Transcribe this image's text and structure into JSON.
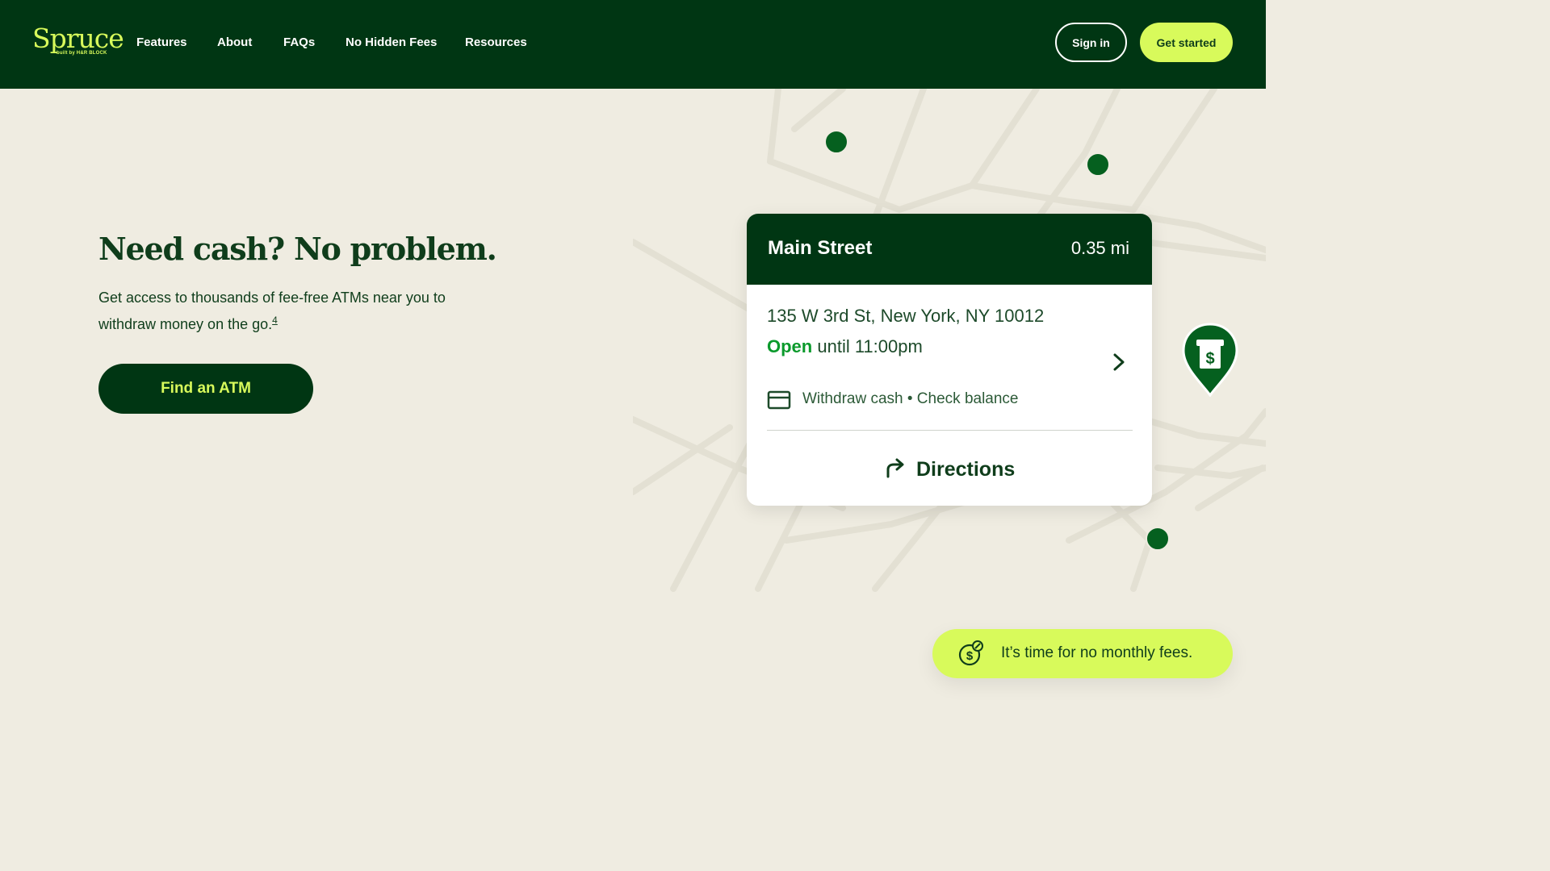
{
  "header": {
    "logo_word": "Spruce",
    "logo_sub": "built by H&R BLOCK",
    "nav": [
      "Features",
      "About",
      "FAQs",
      "No Hidden Fees",
      "Resources"
    ],
    "sign_in": "Sign in",
    "get_started": "Get started"
  },
  "hero": {
    "title": "Need cash? No problem.",
    "description": "Get access to thousands of fee-free ATMs near you to withdraw money on the go.",
    "footnote": "4",
    "cta": "Find an ATM"
  },
  "atm_card": {
    "name": "Main Street",
    "distance": "0.35 mi",
    "address": "135 W 3rd St, New York, NY 10012",
    "status": "Open",
    "hours": "until 11:00pm",
    "services": "Withdraw cash • Check balance",
    "directions": "Directions",
    "icons": [
      "chevron-right-icon",
      "card-icon",
      "directions-arrow-icon"
    ]
  },
  "map": {
    "pin_icon": "atm-dollar-pin-icon",
    "marker_count": 3
  },
  "promo": {
    "icon": "dollar-coin-badge-icon",
    "text": "It’s time for no monthly fees."
  },
  "colors": {
    "brand_dark": "#003613",
    "accent_lime": "#d8fa5b",
    "background": "#efece1",
    "open_green": "#0b9a2c",
    "marker_green": "#05601f"
  }
}
